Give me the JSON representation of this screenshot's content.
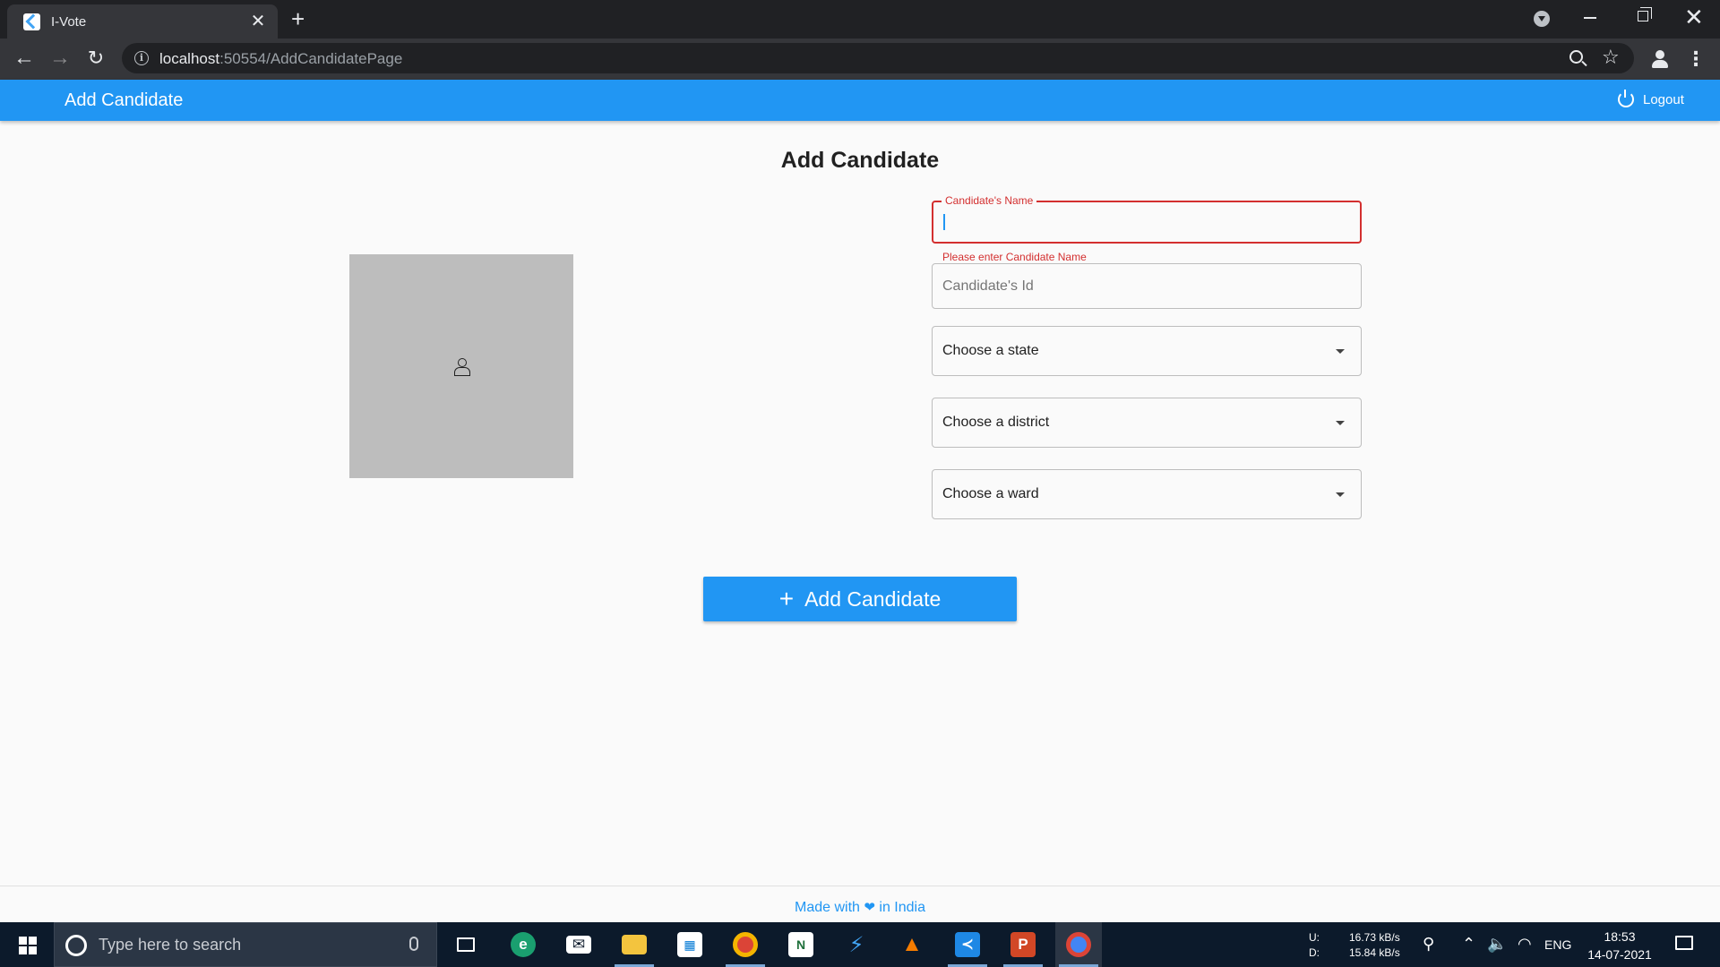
{
  "browser": {
    "tab_title": "I-Vote",
    "tab_close": "✕",
    "new_tab": "+",
    "url_host": "localhost",
    "url_rest": ":50554/AddCandidatePage",
    "window_close": "✕"
  },
  "app": {
    "title": "Add Candidate",
    "logout_label": "Logout",
    "brand_color": "#2196f3",
    "error_color": "#d32f2f"
  },
  "page": {
    "heading": "Add Candidate",
    "fields": {
      "name_label": "Candidate's Name",
      "name_value": "",
      "name_error": "Please enter Candidate Name",
      "id_placeholder": "Candidate's Id"
    },
    "dropdowns": {
      "state": "Choose a state",
      "district": "Choose a district",
      "ward": "Choose a ward"
    },
    "submit_label": "Add Candidate"
  },
  "footer": {
    "before": "Made with ",
    "heart": "❤",
    "after": " in India"
  },
  "taskbar": {
    "search_placeholder": "Type here to search",
    "apps": [
      "task-view",
      "edge",
      "mail",
      "file-explorer",
      "store",
      "chrome-profile",
      "notepad-plus",
      "flutter",
      "vlc",
      "vscode",
      "powerpoint",
      "chrome"
    ],
    "net_up_label": "U:",
    "net_up_value": "16.73 kB/s",
    "net_down_label": "D:",
    "net_down_value": "15.84 kB/s",
    "language": "ENG",
    "time": "18:53",
    "date": "14-07-2021"
  }
}
